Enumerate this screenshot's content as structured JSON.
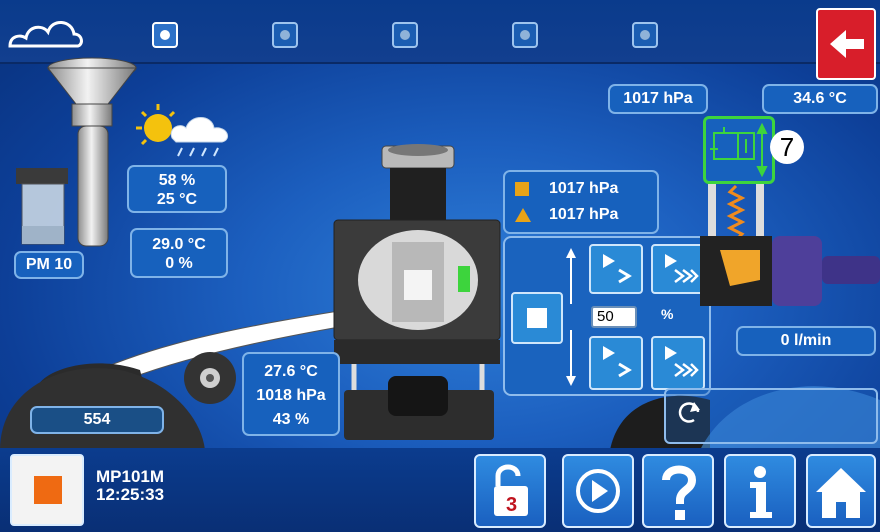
{
  "top_bar": {
    "steps": [
      {
        "name": "step-1",
        "active": true
      },
      {
        "name": "step-2",
        "active": false
      },
      {
        "name": "step-3",
        "active": false
      },
      {
        "name": "step-4",
        "active": false
      },
      {
        "name": "step-5",
        "active": false
      }
    ]
  },
  "left": {
    "humidity": "58 %",
    "ambient_temp": "25 °C",
    "sensor_temp": "29.0 °C",
    "sensor_pct": "0 %",
    "pm_label": "PM 10",
    "counter": "554"
  },
  "center": {
    "temp": "27.6 °C",
    "pressure": "1018 hPa",
    "humidity": "43 %"
  },
  "right": {
    "pressure_top": "1017 hPa",
    "temp_top": "34.6 °C",
    "valve_number": "7",
    "flow": "0 l/min"
  },
  "legend": {
    "square_value": "1017 hPa",
    "triangle_value": "1017 hPa",
    "square_color": "#e8a317",
    "triangle_color": "#e8a317"
  },
  "control": {
    "percent_value": "50",
    "percent_unit": "%"
  },
  "status": {
    "device": "MP101M",
    "time": "12:25:33",
    "lock_badge": "3"
  },
  "colors": {
    "accent": "#1761bd",
    "back_red": "#d81e2a",
    "stop_orange": "#ef6a12",
    "valve_green": "#3dd43d"
  }
}
